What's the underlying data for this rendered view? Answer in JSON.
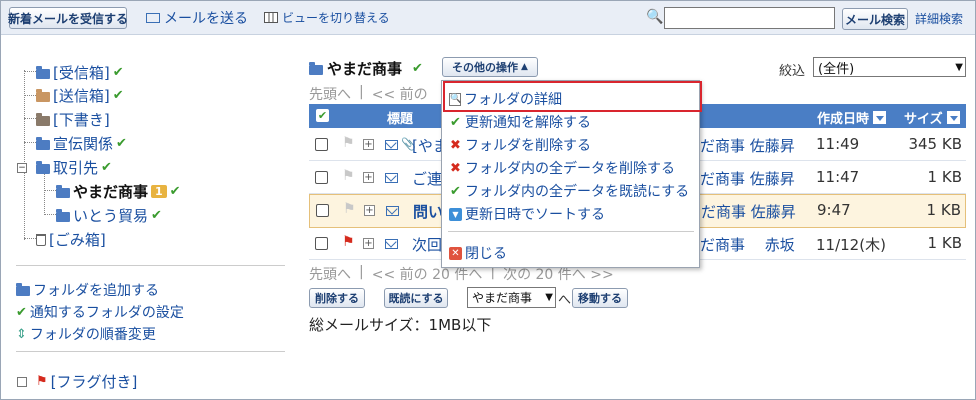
{
  "toolbar": {
    "receive_label": "新着メールを受信する",
    "send_label": "メールを送る",
    "view_label": "ビューを切り替える",
    "search_value": "",
    "search_button": "メール検索",
    "advanced_search": "詳細検索"
  },
  "sidebar": {
    "folders": {
      "inbox": "[受信箱]",
      "sent": "[送信箱]",
      "drafts": "[下書き]",
      "ads": "宣伝関係",
      "clients": "取引先",
      "yamada": "やまだ商事",
      "yamada_badge": "1",
      "ito": "いとう貿易",
      "trash": "[ごみ箱]"
    },
    "actions": {
      "add_folder": "フォルダを追加する",
      "notify_settings": "通知するフォルダの設定",
      "order_change": "フォルダの順番変更"
    },
    "flagged": "[フラグ付き]"
  },
  "main": {
    "folder_title": "やまだ商事",
    "other_ops": "その他の操作",
    "filter_label": "絞込",
    "filter_value": "(全件)",
    "pager_top": {
      "first": "先頭へ",
      "sep": "|",
      "prev": "<< 前の"
    },
    "pager_bottom": {
      "first": "先頭へ",
      "sep": "|",
      "prev": "<< 前の 20 件へ",
      "sep2": "|",
      "next": "次の 20 件へ >>"
    },
    "columns": {
      "subject": "標題",
      "created": "作成日時",
      "size": "サイズ"
    },
    "rows": [
      {
        "subject": "[やま",
        "from": "だ商事 佐藤昇",
        "time": "11:49",
        "size": "345 KB"
      },
      {
        "subject": "ご連",
        "from": "だ商事 佐藤昇",
        "time": "11:47",
        "size": "1 KB"
      },
      {
        "subject": "問い",
        "from": "だ商事 佐藤昇",
        "time": "9:47",
        "size": "1 KB"
      },
      {
        "subject": "次回",
        "from": "だ商事　 赤坂",
        "time": "11/12(木)",
        "size": "1 KB"
      }
    ],
    "bottom": {
      "delete": "削除する",
      "mark_read": "既読にする",
      "move_target": "やまだ商事",
      "move_to": "へ",
      "move": "移動する",
      "total_size": "総メールサイズ：1MB以下"
    }
  },
  "menu": {
    "items": [
      "フォルダの詳細",
      "更新通知を解除する",
      "フォルダを削除する",
      "フォルダ内の全データを削除する",
      "フォルダ内の全データを既読にする",
      "更新日時でソートする",
      "閉じる"
    ]
  },
  "colors": {
    "header_blue": "#4a7ec5",
    "highlight_red": "#d9252e",
    "check_green": "#3a9b2e",
    "flag_red": "#d52b1e"
  }
}
